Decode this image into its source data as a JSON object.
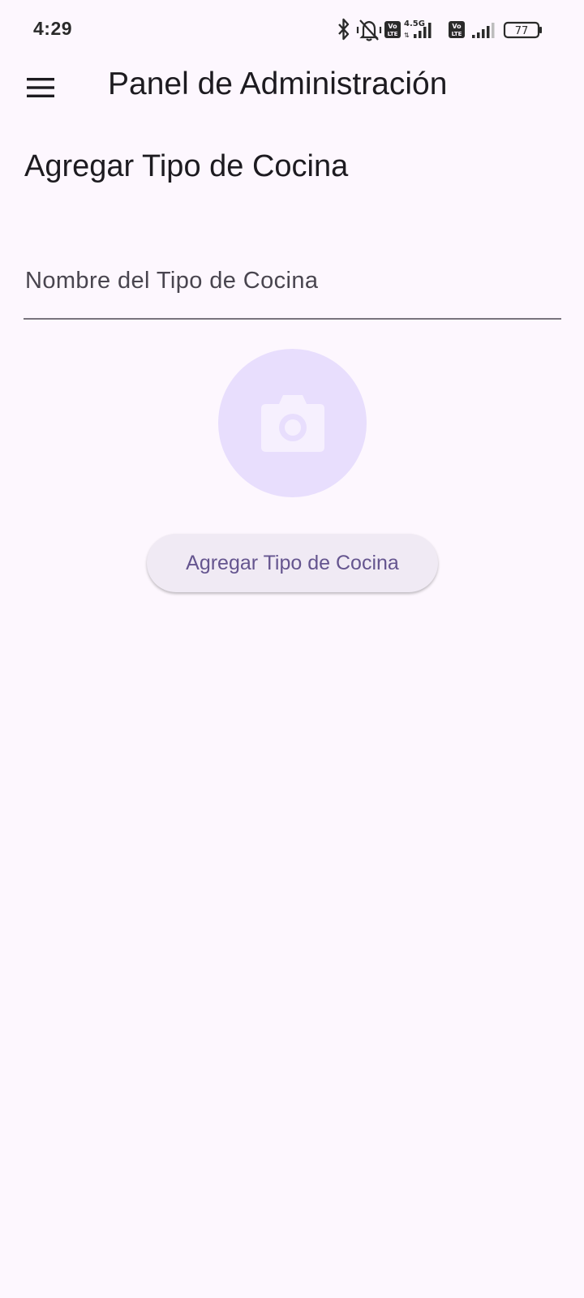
{
  "status_bar": {
    "time": "4:29",
    "network_type": "4.5G",
    "battery_level": "77",
    "icons": [
      "bluetooth-icon",
      "mute-icon",
      "volte-icon",
      "signal-icon",
      "battery-icon"
    ]
  },
  "app_bar": {
    "title": "Panel de Administración",
    "menu_icon": "menu-icon"
  },
  "form": {
    "heading": "Agregar Tipo de Cocina",
    "name_field": {
      "value": "",
      "placeholder": "Nombre del Tipo de Cocina"
    },
    "photo_icon": "camera-icon",
    "submit_label": "Agregar Tipo de Cocina"
  },
  "colors": {
    "background": "#fdf7fe",
    "primary": "#65558f",
    "photo_circle": "#e8defd",
    "button_bg": "#f0eaf4"
  }
}
